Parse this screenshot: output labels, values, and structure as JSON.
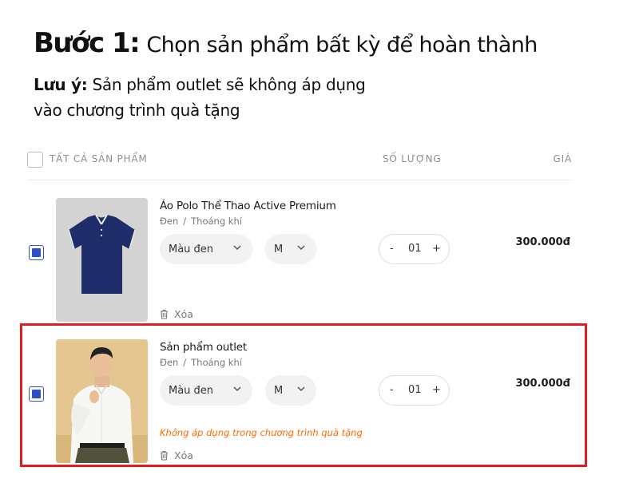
{
  "heading": {
    "step": "Bước 1:",
    "text": "Chọn sản phẩm bất kỳ để hoàn thành"
  },
  "note": {
    "label": "Lưu ý:",
    "line1": "Sản phẩm outlet sẽ không áp dụng",
    "line2": "vào chương trình quà tặng"
  },
  "table_header": {
    "select_all": "TẤT CẢ SẢN PHẨM",
    "quantity": "SỐ LƯỢNG",
    "price": "GIÁ"
  },
  "items": [
    {
      "name": "Áo Polo Thể Thao Active Premium",
      "color": "Đen",
      "feature": "Thoáng khí",
      "color_select": "Màu đen",
      "size_select": "M",
      "qty_minus": "-",
      "qty": "01",
      "qty_plus": "+",
      "price": "300.000đ",
      "delete_label": "Xóa",
      "checked": true
    },
    {
      "name": "Sản phẩm outlet",
      "color": "Đen",
      "feature": "Thoáng khí",
      "color_select": "Màu đen",
      "size_select": "M",
      "qty_minus": "-",
      "qty": "01",
      "qty_plus": "+",
      "price": "300.000đ",
      "warning": "Không áp dụng trong chương trình quà tặng",
      "delete_label": "Xóa",
      "checked": true
    }
  ],
  "colors": {
    "checkbox": "#2b4fd1",
    "warning": "#ff6a00",
    "highlight_border": "#e11d1d"
  },
  "icons": {
    "chevron": "chevron-down-icon",
    "trash": "trash-icon"
  }
}
